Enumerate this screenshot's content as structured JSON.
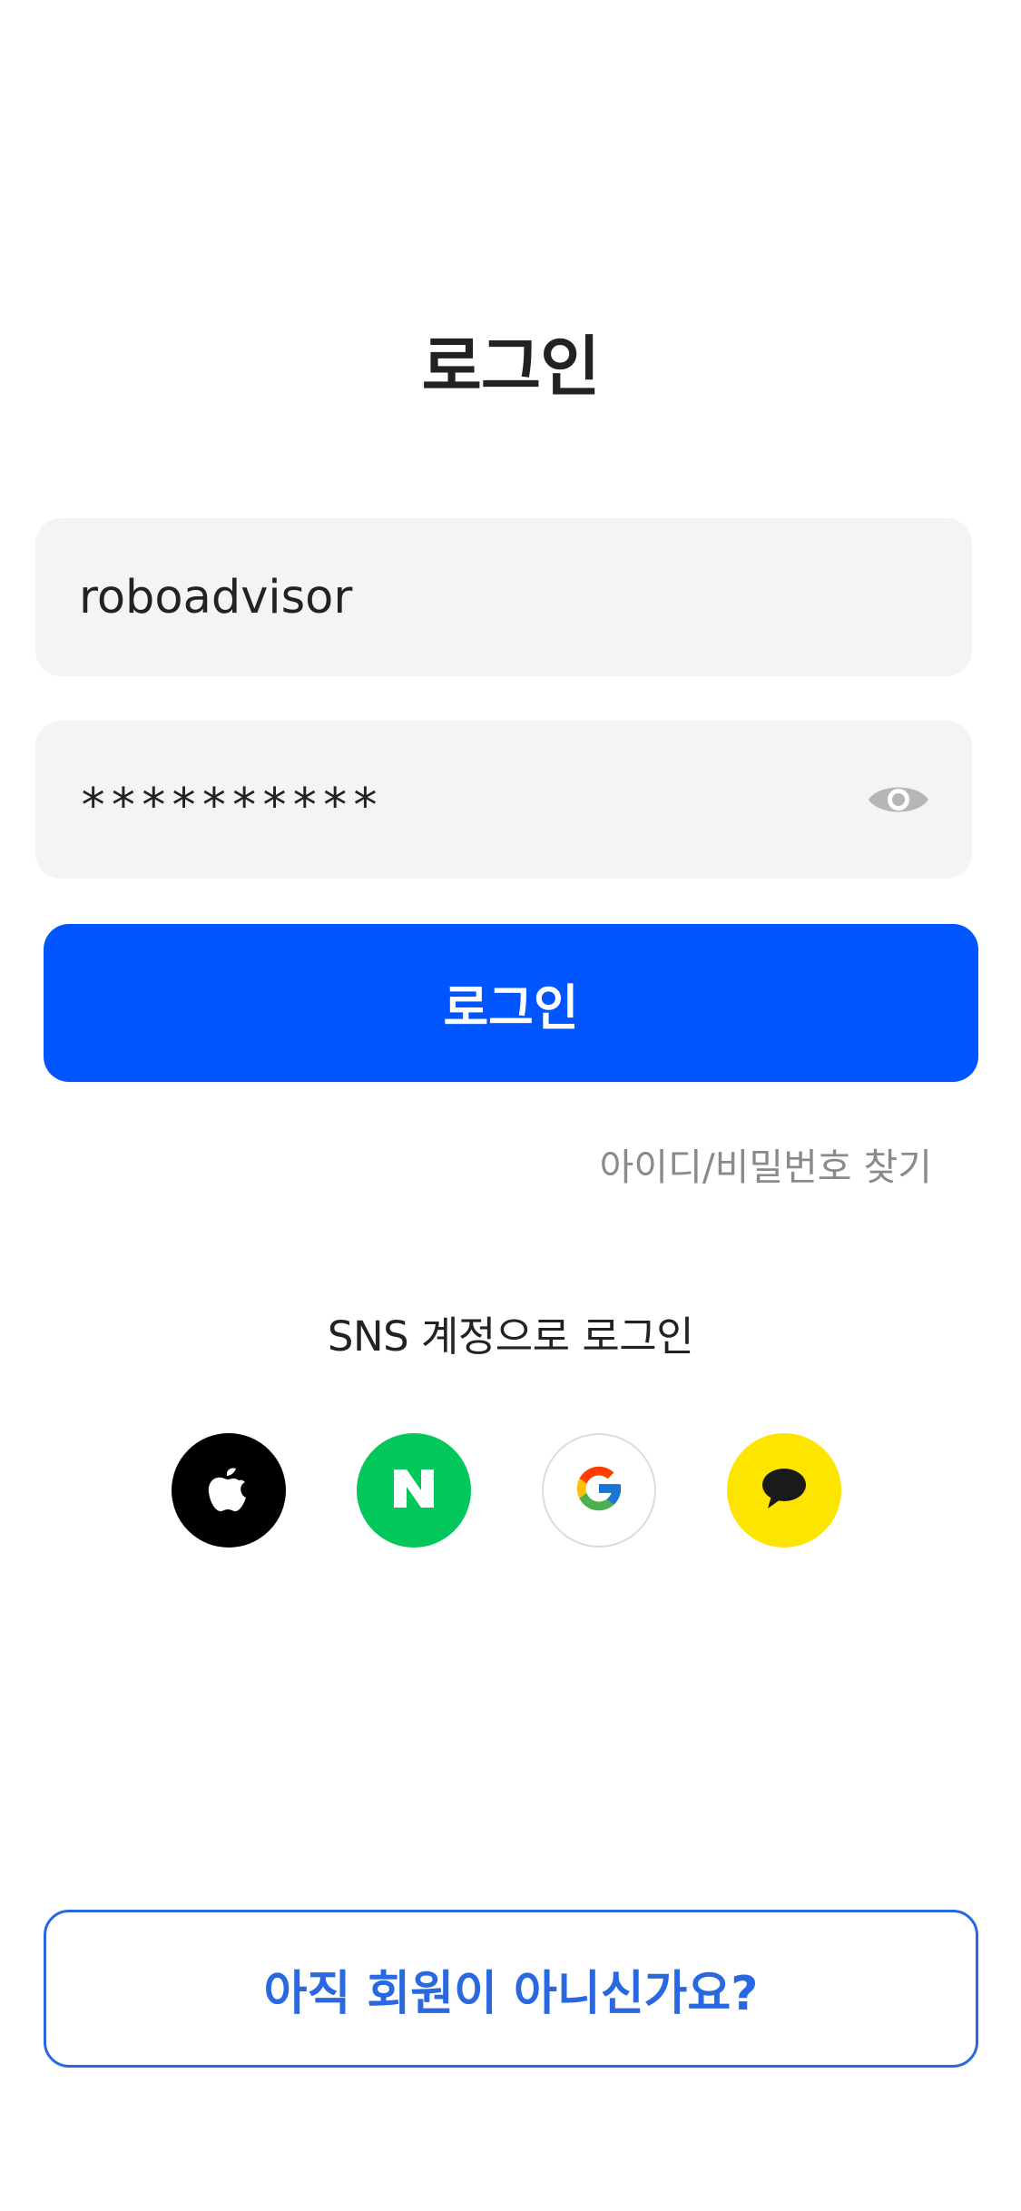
{
  "header": {
    "title": "로그인"
  },
  "form": {
    "username": {
      "value": "roboadvisor",
      "placeholder": ""
    },
    "password": {
      "value": "**********",
      "placeholder": "",
      "toggle_icon": "eye-icon"
    },
    "login_label": "로그인",
    "find_account_label": "아이디/비밀번호 찾기"
  },
  "sns": {
    "title": "SNS 계정으로 로그인",
    "providers": [
      {
        "name": "apple",
        "icon": "apple-icon",
        "color": "#000000"
      },
      {
        "name": "naver",
        "icon": "naver-icon",
        "color": "#03c75a"
      },
      {
        "name": "google",
        "icon": "google-icon",
        "color": "#ffffff"
      },
      {
        "name": "kakao",
        "icon": "kakao-icon",
        "color": "#fee500"
      }
    ]
  },
  "footer": {
    "signup_label": "아직 회원이 아니신가요?"
  },
  "colors": {
    "primary": "#0055ff",
    "signup_accent": "#2a68e0",
    "field_background": "#f4f4f4",
    "muted_text": "#8a8a8a"
  }
}
